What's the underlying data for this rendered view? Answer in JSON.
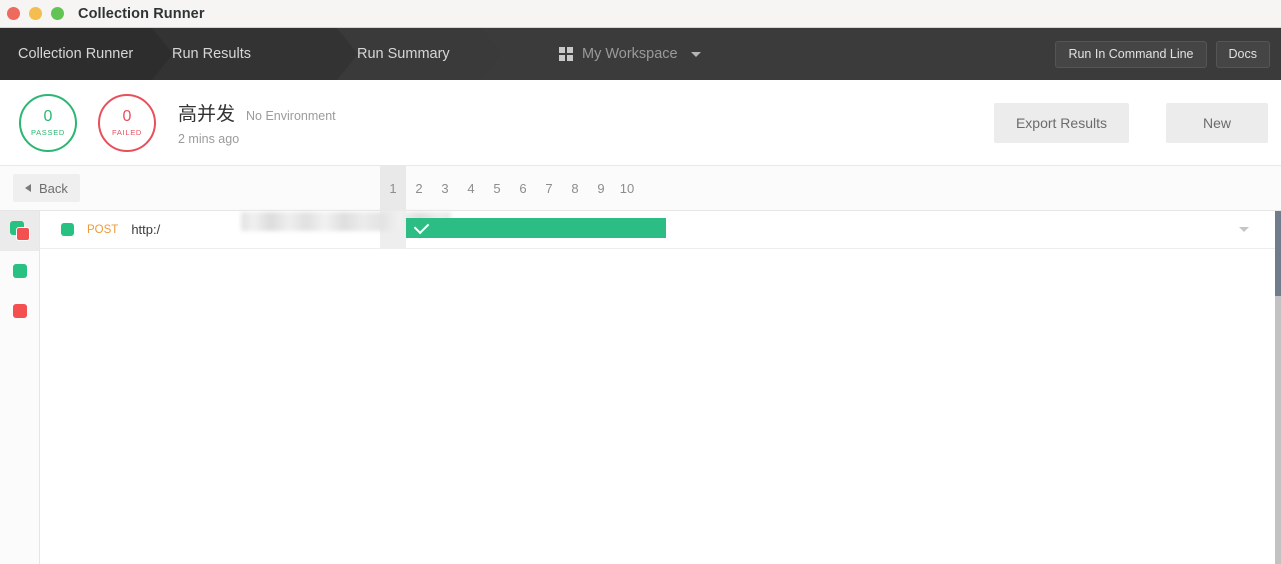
{
  "window": {
    "title": "Collection Runner",
    "controls": [
      "close",
      "minimize",
      "maximize"
    ]
  },
  "nav": {
    "breadcrumbs": [
      {
        "label": "Collection Runner"
      },
      {
        "label": "Run Results"
      },
      {
        "label": "Run Summary"
      }
    ],
    "workspace": {
      "icon": "grid-icon",
      "label": "My Workspace",
      "caret": "chevron-down-icon"
    },
    "actions": [
      {
        "label": "Run In Command Line"
      },
      {
        "label": "Docs"
      }
    ]
  },
  "summary": {
    "passed": {
      "value": "0",
      "label": "PASSED",
      "color": "#2bb673"
    },
    "failed": {
      "value": "0",
      "label": "FAILED",
      "color": "#e8505b"
    },
    "run_name": "高并发",
    "environment": "No Environment",
    "timestamp": "2 mins ago",
    "buttons": {
      "export": "Export Results",
      "new": "New"
    }
  },
  "toolbar": {
    "back_label": "Back",
    "pages": [
      "1",
      "2",
      "3",
      "4",
      "5",
      "6",
      "7",
      "8",
      "9",
      "10"
    ],
    "active_page": "1"
  },
  "filters": [
    {
      "name": "all",
      "icon": "stacked-squares-icon",
      "selected": true
    },
    {
      "name": "passed",
      "icon": "green-square-icon",
      "selected": false
    },
    {
      "name": "failed",
      "icon": "red-square-icon",
      "selected": false
    }
  ],
  "results": [
    {
      "status_color": "#27c281",
      "method": "POST",
      "url_prefix": "http:/",
      "url_redacted": true,
      "url_ellipsis": "...",
      "test_result": "pass",
      "test_icon": "check-icon",
      "expand_icon": "chevron-down-icon"
    }
  ]
}
